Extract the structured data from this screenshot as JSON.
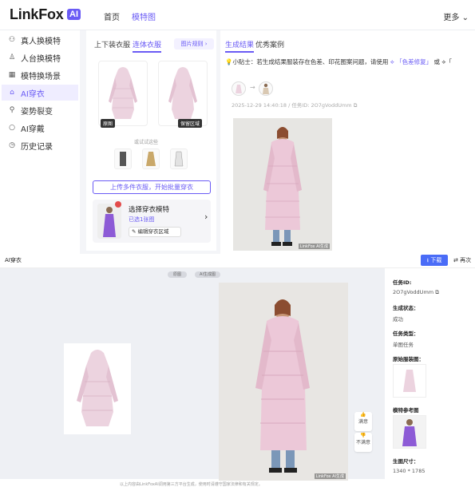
{
  "brand": {
    "name": "LinkFox",
    "badge": "AI"
  },
  "nav": {
    "home": "首页",
    "model": "模特图",
    "more": "更多"
  },
  "sidebar": {
    "items": [
      {
        "label": "真人换模特",
        "icon": "person-icon"
      },
      {
        "label": "人台换模特",
        "icon": "mannequin-icon"
      },
      {
        "label": "模特换场景",
        "icon": "scene-icon"
      },
      {
        "label": "AI穿衣",
        "icon": "ai-dress-icon",
        "active": true
      },
      {
        "label": "姿势裂变",
        "icon": "pose-icon"
      },
      {
        "label": "AI穿戴",
        "icon": "wear-icon"
      },
      {
        "label": "历史记录",
        "icon": "history-icon"
      }
    ]
  },
  "center": {
    "tab_top_bottom": "上下装衣服",
    "tab_onepiece": "连体衣服",
    "example_link": "图片规则",
    "label_original": "原图",
    "label_keep": "保留区域",
    "try_hint": "或试试这些",
    "upload_batch": "上传多件衣服，开始批量穿衣",
    "model_card": {
      "title": "选择穿衣模特",
      "selected": "已选1张图",
      "edit": "编辑穿衣区域"
    }
  },
  "right": {
    "tab_results": "生成结果",
    "tab_cases": "优秀案例",
    "tip": "小贴士：若生成结果服装存在色差、印花图案问题，请使用",
    "tip_link": "「色差修复」",
    "tip_or": "或",
    "tip_more": "「",
    "timestamp": "2025-12-29 14:40:18 / 任务ID: 2O7gVoddUmm",
    "watermark": "LinkFox AI生成"
  },
  "detail": {
    "title": "AI穿衣",
    "download": "下载",
    "regen": "再次",
    "pill_original": "原图",
    "pill_ai": "AI生成图",
    "feedback_satisfied": "满意",
    "feedback_unsatisfied": "不满意",
    "footer_note": "以上内容由LinkFoxAI调用第三方平台生成，使用时请遵守国家法律和有关规定。",
    "info": {
      "task_id_label": "任务ID:",
      "task_id": "2O7gVoddUmm",
      "status_label": "生成状态：",
      "status": "成功",
      "type_label": "任务类型：",
      "type": "单图任务",
      "orig_label": "原始服装图：",
      "model_label": "模特参考图",
      "size_label": "生图尺寸：",
      "size": "1340 * 1785"
    }
  },
  "colors": {
    "accent": "#6a5bf5",
    "coat": "#e9c8d8",
    "jeans": "#6f8fb3"
  }
}
